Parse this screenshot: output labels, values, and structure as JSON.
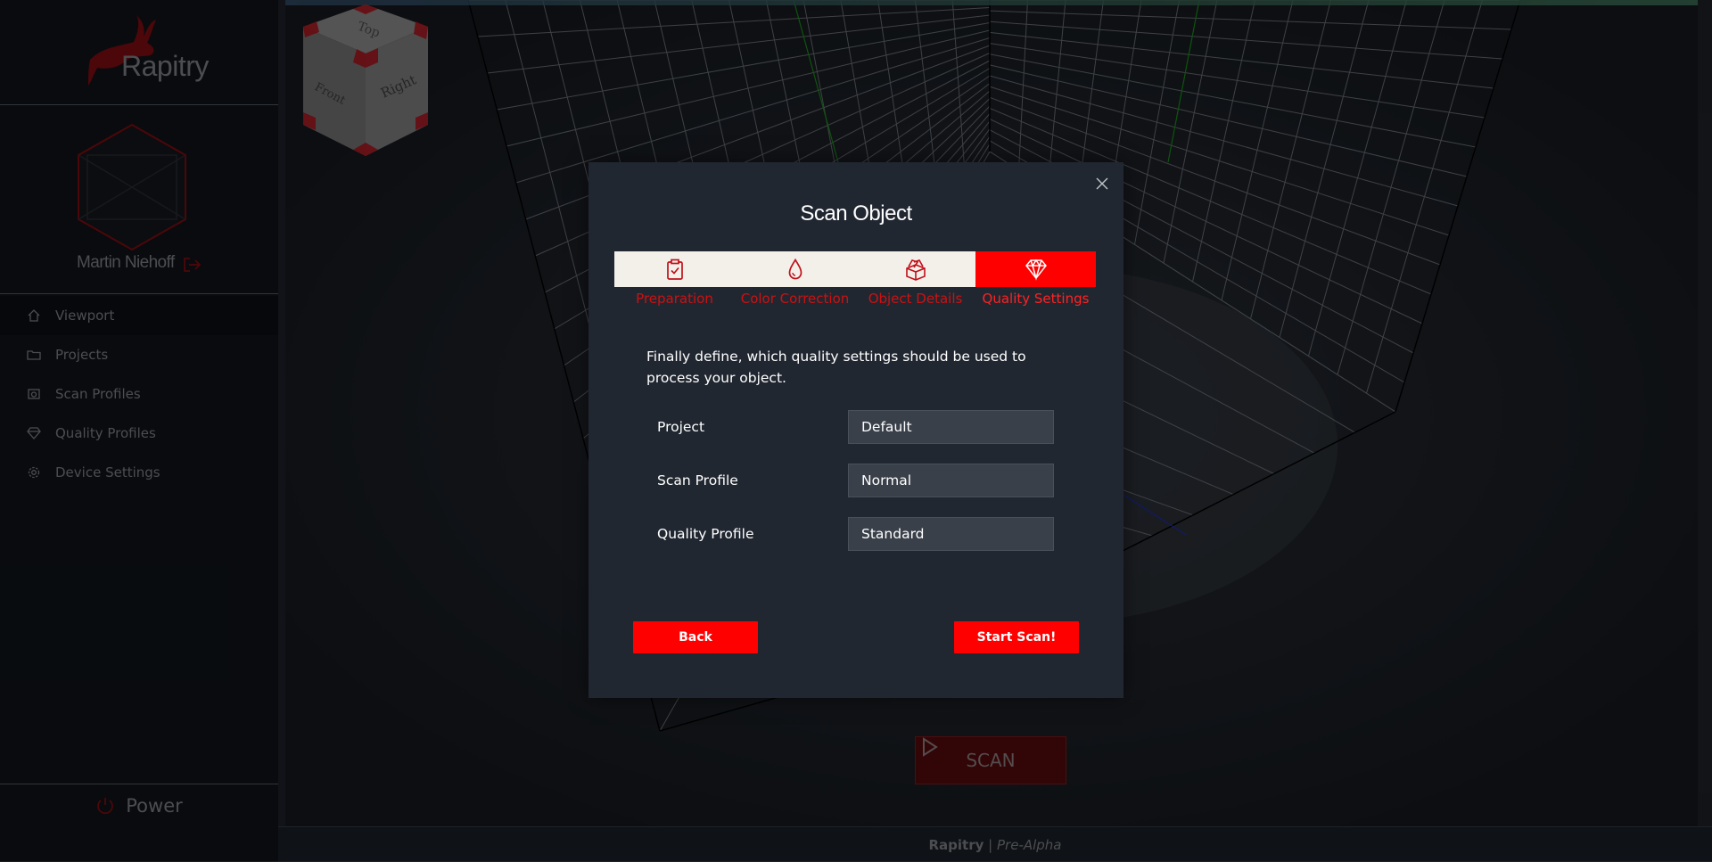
{
  "app": {
    "name": "Rapitry"
  },
  "user": {
    "name": "Martin Niehoff"
  },
  "sidebar": {
    "items": [
      {
        "label": "Viewport",
        "icon": "home-icon",
        "bar_color": "#2f5a8a"
      },
      {
        "label": "Projects",
        "icon": "folder-icon",
        "bar_color": "#1f8a7a"
      },
      {
        "label": "Scan Profiles",
        "icon": "camera-icon",
        "bar_color": "#3aa04a"
      },
      {
        "label": "Quality Profiles",
        "icon": "diamond-icon",
        "bar_color": "#a8a020"
      },
      {
        "label": "Device Settings",
        "icon": "gear-icon",
        "bar_color": "#b02020"
      }
    ],
    "power_label": "Power"
  },
  "footer": {
    "brand": "Rapitry",
    "separator": "|",
    "stage": "Pre-Alpha"
  },
  "viewport": {
    "scan_button_label": "SCAN",
    "cube_faces": [
      "Top",
      "Front",
      "Right"
    ]
  },
  "modal": {
    "title": "Scan Object",
    "steps": [
      {
        "label": "Preparation",
        "icon": "clipboard-check-icon",
        "active": false
      },
      {
        "label": "Color Correction",
        "icon": "drop-icon",
        "active": false
      },
      {
        "label": "Object Details",
        "icon": "boxes-icon",
        "active": false
      },
      {
        "label": "Quality Settings",
        "icon": "diamond-icon",
        "active": true
      }
    ],
    "intro": "Finally define, which quality settings should be used to process your object.",
    "fields": [
      {
        "label": "Project",
        "value": "Default"
      },
      {
        "label": "Scan Profile",
        "value": "Normal"
      },
      {
        "label": "Quality Profile",
        "value": "Standard"
      }
    ],
    "back_label": "Back",
    "start_label": "Start Scan!"
  },
  "colors": {
    "accent": "#ff0000",
    "modal_bg": "#212731",
    "sidebar_bg": "#11151b"
  }
}
